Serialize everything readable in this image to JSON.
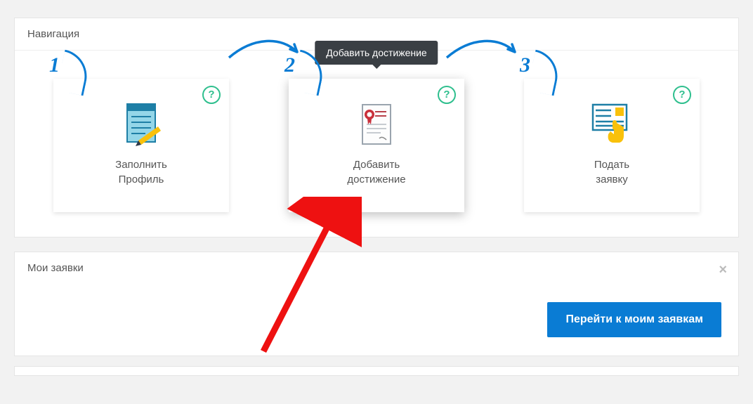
{
  "nav": {
    "title": "Навигация",
    "tooltip": "Добавить достижение",
    "steps": [
      {
        "num": "1",
        "label_l1": "Заполнить",
        "label_l2": "Профиль"
      },
      {
        "num": "2",
        "label_l1": "Добавить",
        "label_l2": "достижение"
      },
      {
        "num": "3",
        "label_l1": "Подать",
        "label_l2": "заявку"
      }
    ]
  },
  "apps": {
    "title": "Мои заявки",
    "button": "Перейти к моим заявкам"
  }
}
